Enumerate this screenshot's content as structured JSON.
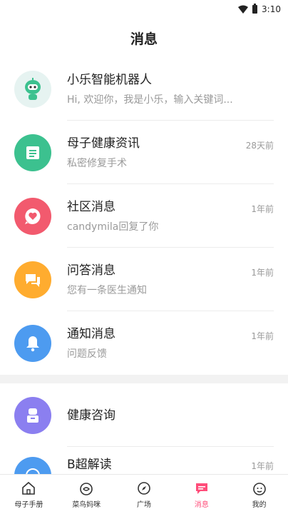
{
  "status": {
    "time": "3:10"
  },
  "title": "消息",
  "messages": [
    {
      "name": "小乐智能机器人",
      "preview": "Hi, 欢迎你，我是小乐，输入关键词...",
      "time": "",
      "color": "#e6f3f1",
      "icon": "robot-icon"
    },
    {
      "name": "母子健康资讯",
      "preview": "私密修复手术",
      "time": "28天前",
      "color": "#3cc18f",
      "icon": "newspaper-icon"
    },
    {
      "name": "社区消息",
      "preview": "candymila回复了你",
      "time": "1年前",
      "color": "#f25a6e",
      "icon": "heart-bubble-icon"
    },
    {
      "name": "问答消息",
      "preview": "您有一条医生通知",
      "time": "1年前",
      "color": "#ffac2f",
      "icon": "chat-icon"
    },
    {
      "name": "通知消息",
      "preview": "问题反馈",
      "time": "1年前",
      "color": "#4d9bf0",
      "icon": "bell-icon"
    },
    {
      "name": "健康咨询",
      "preview": "",
      "time": "",
      "color": "#8b7ff0",
      "icon": "doctor-icon"
    },
    {
      "name": "B超解读",
      "preview": "",
      "time": "1年前",
      "color": "#4d9bf0",
      "icon": "ultrasound-icon"
    }
  ],
  "tabs": [
    {
      "label": "母子手册",
      "icon": "home-icon"
    },
    {
      "label": "菜鸟妈咪",
      "icon": "egg-icon"
    },
    {
      "label": "广场",
      "icon": "compass-icon"
    },
    {
      "label": "消息",
      "icon": "message-icon",
      "active": true
    },
    {
      "label": "我的",
      "icon": "profile-icon"
    }
  ],
  "colors": {
    "accent": "#ff4d7a"
  }
}
